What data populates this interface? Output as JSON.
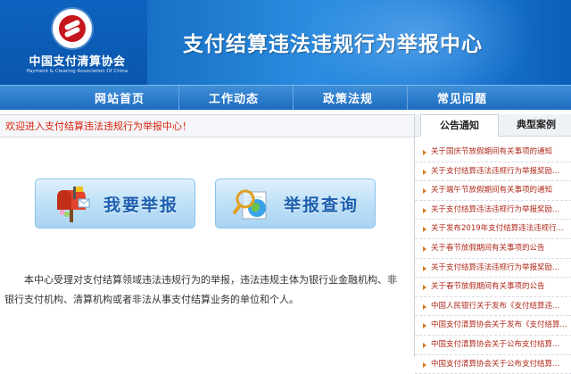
{
  "header": {
    "org_name_cn": "中国支付清算协会",
    "org_name_en": "Payment & Clearing Association Of China",
    "site_title": "支付结算违法违规行为举报中心"
  },
  "nav": {
    "items": [
      "网站首页",
      "工作动态",
      "政策法规",
      "常见问题"
    ]
  },
  "welcome": {
    "text": "欢迎进入支付结算违法违规行为举报中心！"
  },
  "actions": {
    "report_label": "我要举报",
    "query_label": "举报查询"
  },
  "description": {
    "text": "本中心受理对支付结算领域违法违规行为的举报，违法违规主体为银行业金融机构、非银行支付机构、清算机构或者非法从事支付结算业务的单位和个人。"
  },
  "panel": {
    "tabs": [
      "公告通知",
      "典型案例"
    ],
    "active_tab": "公告通知",
    "news": [
      "关于国庆节放假期间有关事项的通知",
      "关于支付结算违法违规行为举报奖励...",
      "关于端午节放假期间有关事项的通知",
      "关于支付结算违法违规行为举报奖励...",
      "关于发布2019年支付结算违法违规行...",
      "关于春节放假期间有关事项的公告",
      "关于支付结算违法违规行为举报奖励...",
      "关于春节放假期间有关事项的公告",
      "中国人民银行关于发布《支付结算违...",
      "中国支付清算协会关于发布《支付结算...",
      "中国支付清算协会关于公布支付结算...",
      "中国支付清算协会关于公布支付结算..."
    ]
  },
  "colors": {
    "header_blue": "#1a74c9",
    "nav_blue": "#1d6cc1",
    "welcome_red": "#d9230f",
    "news_red": "#b02a1c",
    "button_text": "#1b5fae"
  }
}
